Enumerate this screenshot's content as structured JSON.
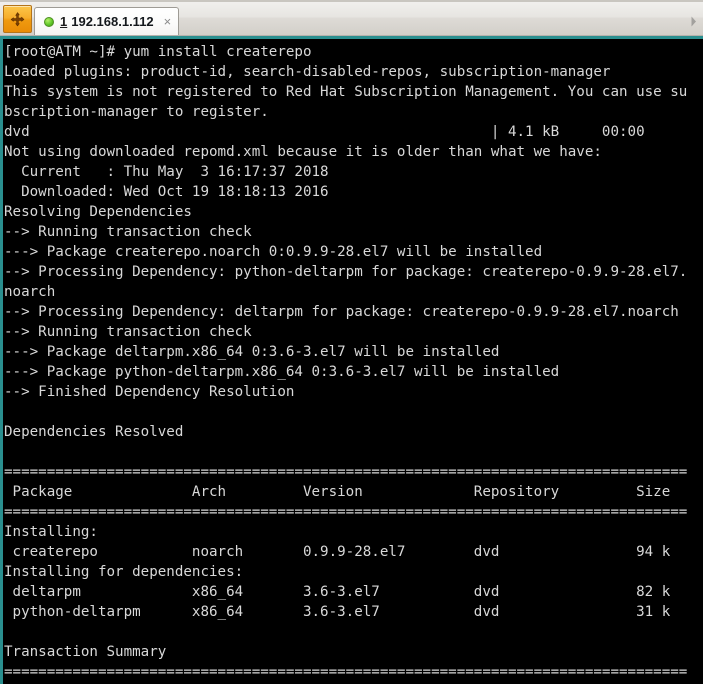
{
  "window": {
    "app_button_icon": "move-cross-icon",
    "tab_scroll_right_icon": "chevron-right-icon"
  },
  "tab": {
    "status_icon": "green-status-dot-icon",
    "index": "1",
    "title": "192.168.1.112",
    "close_label": "×"
  },
  "terminal": {
    "prompt": "[root@ATM ~]#",
    "command": "yum install createrepo",
    "host": "ATM",
    "user": "root",
    "cwd": "~",
    "columns": 82,
    "colors": {
      "background": "#000000",
      "foreground": "#d8d8d8",
      "accent_border": "#2a8f8f"
    },
    "lines": [
      "[root@ATM ~]# yum install createrepo",
      "Loaded plugins: product-id, search-disabled-repos, subscription-manager",
      "This system is not registered to Red Hat Subscription Management. You can use su",
      "bscription-manager to register.",
      "dvd                                                      | 4.1 kB     00:00",
      "Not using downloaded repomd.xml because it is older than what we have:",
      "  Current   : Thu May  3 16:17:37 2018",
      "  Downloaded: Wed Oct 19 18:18:13 2016",
      "Resolving Dependencies",
      "--> Running transaction check",
      "---> Package createrepo.noarch 0:0.9.9-28.el7 will be installed",
      "--> Processing Dependency: python-deltarpm for package: createrepo-0.9.9-28.el7.",
      "noarch",
      "--> Processing Dependency: deltarpm for package: createrepo-0.9.9-28.el7.noarch",
      "--> Running transaction check",
      "---> Package deltarpm.x86_64 0:3.6-3.el7 will be installed",
      "---> Package python-deltarpm.x86_64 0:3.6-3.el7 will be installed",
      "--> Finished Dependency Resolution",
      "",
      "Dependencies Resolved",
      "",
      "================================================================================",
      " Package              Arch         Version             Repository         Size",
      "================================================================================",
      "Installing:",
      " createrepo           noarch       0.9.9-28.el7        dvd                94 k",
      "Installing for dependencies:",
      " deltarpm             x86_64       3.6-3.el7           dvd                82 k",
      " python-deltarpm      x86_64       3.6-3.el7           dvd                31 k",
      "",
      "Transaction Summary",
      "================================================================================"
    ],
    "repo_download": {
      "repo": "dvd",
      "size": "4.1 kB",
      "time": "00:00"
    },
    "repomd_timestamps": {
      "current": "Thu May  3 16:17:37 2018",
      "downloaded": "Wed Oct 19 18:18:13 2016"
    },
    "table": {
      "headers": [
        "Package",
        "Arch",
        "Version",
        "Repository",
        "Size"
      ],
      "groups": [
        {
          "label": "Installing:",
          "rows": [
            [
              "createrepo",
              "noarch",
              "0.9.9-28.el7",
              "dvd",
              "94 k"
            ]
          ]
        },
        {
          "label": "Installing for dependencies:",
          "rows": [
            [
              "deltarpm",
              "x86_64",
              "3.6-3.el7",
              "dvd",
              "82 k"
            ],
            [
              "python-deltarpm",
              "x86_64",
              "3.6-3.el7",
              "dvd",
              "31 k"
            ]
          ]
        }
      ]
    },
    "summary_heading": "Transaction Summary"
  }
}
